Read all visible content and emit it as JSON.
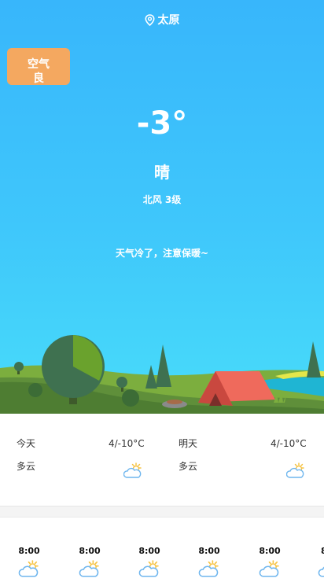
{
  "header": {
    "city": "太原"
  },
  "aqi": {
    "label": "空气",
    "level": "良",
    "color": "#f4a860"
  },
  "current": {
    "temperature": "-3°",
    "condition": "晴",
    "wind": "北风 3级",
    "tip": "天气冷了，注意保暖~"
  },
  "forecast": [
    {
      "day": "今天",
      "range": "4/-10°C",
      "condition": "多云",
      "icon": "partly-cloudy-icon"
    },
    {
      "day": "明天",
      "range": "4/-10°C",
      "condition": "多云",
      "icon": "partly-cloudy-icon"
    }
  ],
  "hourly": [
    {
      "time": "8:00",
      "icon": "partly-cloudy-icon"
    },
    {
      "time": "8:00",
      "icon": "partly-cloudy-icon"
    },
    {
      "time": "8:00",
      "icon": "partly-cloudy-icon"
    },
    {
      "time": "8:00",
      "icon": "partly-cloudy-icon"
    },
    {
      "time": "8:00",
      "icon": "partly-cloudy-icon"
    },
    {
      "time": "8",
      "icon": "partly-cloudy-icon"
    }
  ],
  "colors": {
    "sky_top": "#38b6fb",
    "sky_bottom": "#48dcf9",
    "tent": "#ef6a5c"
  }
}
